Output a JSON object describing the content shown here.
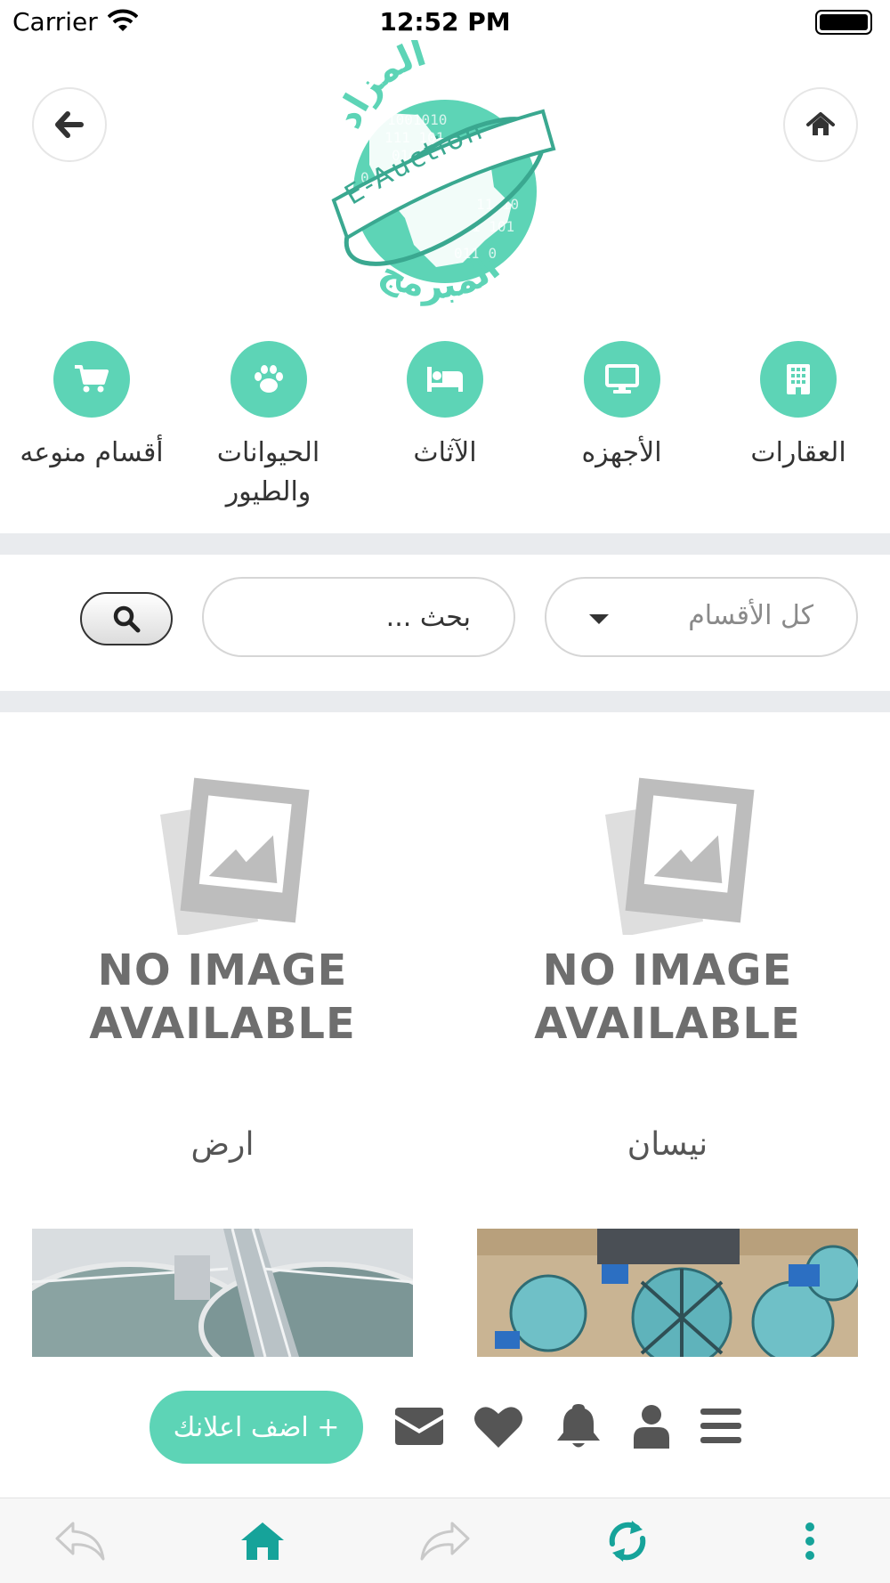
{
  "status_bar": {
    "carrier": "Carrier",
    "time": "12:52 PM"
  },
  "header": {
    "back_icon": "arrow-left-icon",
    "home_icon": "home-icon",
    "logo": {
      "arabic_top": "المزاد",
      "arabic_bottom": "المبرمج",
      "ribbon": "E-Auction",
      "binary": [
        "1001010",
        "111 101",
        "010110",
        "0  1  1",
        "11   10",
        "1  101",
        "011 0"
      ]
    }
  },
  "categories": [
    {
      "label": "العقارات",
      "icon": "building-icon"
    },
    {
      "label": "الأجهزه",
      "icon": "monitor-icon"
    },
    {
      "label": "الآثاث",
      "icon": "bed-icon"
    },
    {
      "label": "الحيوانات والطيور",
      "icon": "paw-icon"
    },
    {
      "label": "أقسام منوعه",
      "icon": "cart-icon"
    }
  ],
  "search": {
    "category_select": "كل الأقسام",
    "placeholder": "بحث ...",
    "button_icon": "search-icon"
  },
  "listings": [
    {
      "title": "نيسان",
      "image": "NO IMAGE AVAILABLE",
      "image_line1": "NO IMAGE",
      "image_line2": "AVAILABLE"
    },
    {
      "title": "ارض",
      "image": "NO IMAGE AVAILABLE",
      "image_line1": "NO IMAGE",
      "image_line2": "AVAILABLE"
    }
  ],
  "photo_listings": [
    {
      "image": "water-treatment-aerial-photo"
    },
    {
      "image": "water-treatment-tank-photo"
    }
  ],
  "action_bar": {
    "add_button": "+ اضف اعلانك",
    "icons": [
      "envelope-icon",
      "heart-icon",
      "bell-icon",
      "user-icon",
      "menu-icon"
    ]
  },
  "browser_bar": {
    "icons": [
      "back-arrow-icon",
      "home-icon",
      "forward-arrow-icon",
      "refresh-icon",
      "more-icon"
    ]
  },
  "colors": {
    "accent": "#5dd4b6",
    "teal_dark": "#16a39a",
    "divider": "#e9ebee"
  }
}
